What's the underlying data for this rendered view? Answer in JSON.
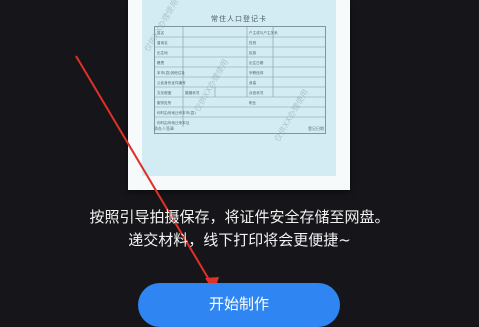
{
  "card": {
    "title": "常住人口登记卡",
    "rows": [
      [
        "姓名",
        "",
        "户主或与户主关系",
        ""
      ],
      [
        "曾用名",
        "",
        "性别",
        ""
      ],
      [
        "出生地",
        "",
        "民族",
        ""
      ],
      [
        "籍贯",
        "",
        "出生日期",
        ""
      ],
      [
        "本市(县)其他住址",
        "",
        "宗教信仰",
        ""
      ],
      [
        "公民身份证件编号",
        "",
        "身高",
        ""
      ],
      [
        "文化程度",
        "婚姻状况",
        "兵役状况",
        ""
      ],
      [
        "服务处所",
        "",
        "职业",
        ""
      ],
      [
        "何时由何地迁来本市(县)",
        "",
        "",
        ""
      ],
      [
        "何时由何地迁来本址",
        "",
        "",
        ""
      ]
    ],
    "footer_left": "承办人签章",
    "footer_right": "登记日期",
    "watermark": "仅供XX办理使用"
  },
  "instructions": {
    "line1": "按照引导拍摄保存，将证件安全存储至网盘。",
    "line2": "递交材料，线下打印将会更便捷~"
  },
  "start_button": {
    "label": "开始制作"
  },
  "colors": {
    "accent": "#2f86f3",
    "arrow": "#e0302a",
    "background": "#16161a"
  }
}
